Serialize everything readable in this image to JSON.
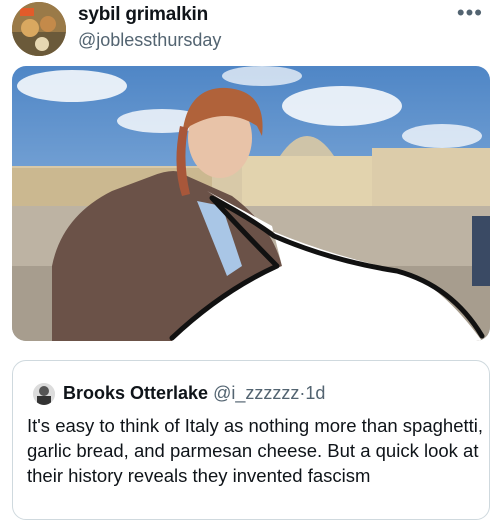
{
  "author": {
    "display_name": "sybil grimalkin",
    "handle": "@joblessthursday"
  },
  "more_menu": {
    "label": "•••"
  },
  "media": {
    "icon": "photo-with-drawn-speech-bubble"
  },
  "quoted_tweet": {
    "display_name": "Brooks Otterlake",
    "handle": "@i_zzzzzz",
    "separator": "·",
    "time": "1d",
    "text": "It's easy to think of Italy as nothing more than spaghetti, garlic bread, and parmesan cheese. But a quick look at their history reveals they invented fascism"
  }
}
